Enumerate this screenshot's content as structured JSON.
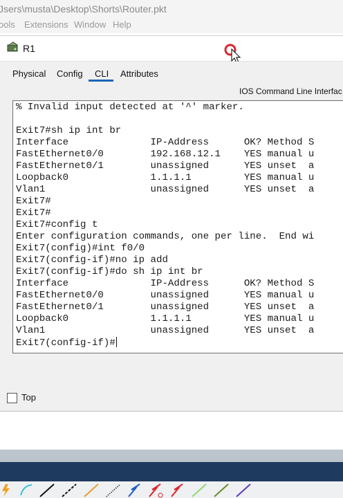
{
  "app": {
    "file_path": "Jsers\\musta\\Desktop\\Shorts\\Router.pkt",
    "menu": [
      "ools",
      "Extensions",
      "Window",
      "Help"
    ]
  },
  "window": {
    "title": "R1",
    "tabs": [
      "Physical",
      "Config",
      "CLI",
      "Attributes"
    ],
    "active_tab": "CLI",
    "section_label": "IOS Command Line Interfac",
    "top_checkbox_label": "Top",
    "top_checked": false
  },
  "console": {
    "lines": [
      "% Invalid input detected at '^' marker.",
      "",
      "Exit7#sh ip int br",
      "Interface              IP-Address      OK? Method S",
      "FastEthernet0/0        192.168.12.1    YES manual u",
      "FastEthernet0/1        unassigned      YES unset  a",
      "Loopback0              1.1.1.1         YES manual u",
      "Vlan1                  unassigned      YES unset  a",
      "Exit7#",
      "Exit7#",
      "Exit7#config t",
      "Enter configuration commands, one per line.  End wi",
      "Exit7(config)#int f0/0",
      "Exit7(config-if)#no ip add",
      "Exit7(config-if)#do sh ip int br",
      "Interface              IP-Address      OK? Method S",
      "FastEthernet0/0        unassigned      YES manual u",
      "FastEthernet0/1        unassigned      YES unset  a",
      "Loopback0              1.1.1.1         YES manual u",
      "Vlan1                  unassigned      YES unset  a",
      "Exit7(config-if)#"
    ]
  },
  "icons": {
    "router": "router-icon",
    "record": "record-icon",
    "cursor": "mouse-cursor-icon"
  },
  "colors": {
    "tab_underline": "#1a66b8",
    "record_red": "#d9262c",
    "taskbar": "#1f3a5f"
  }
}
